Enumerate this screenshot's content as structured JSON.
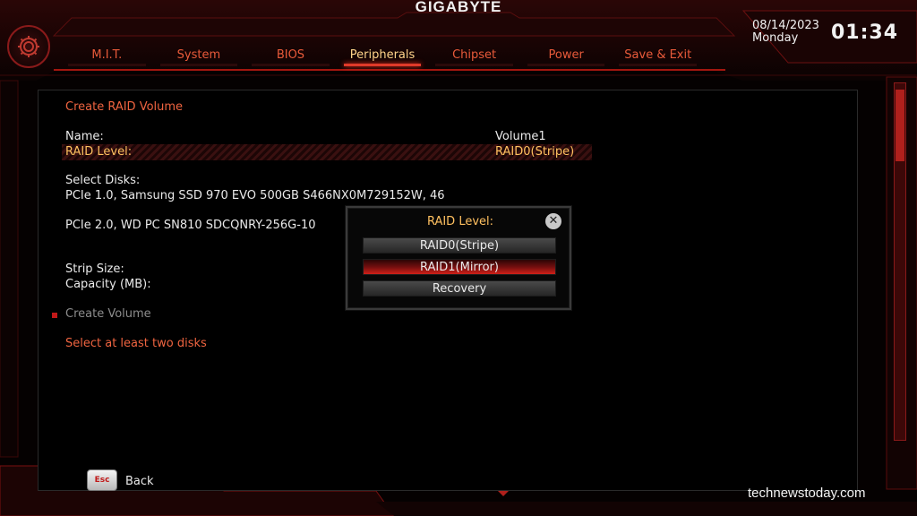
{
  "brand": "GIGABYTE",
  "header": {
    "date": "08/14/2023",
    "day": "Monday",
    "time": "01:34"
  },
  "tabs": [
    {
      "label": "M.I.T.",
      "active": false
    },
    {
      "label": "System",
      "active": false
    },
    {
      "label": "BIOS",
      "active": false
    },
    {
      "label": "Peripherals",
      "active": true
    },
    {
      "label": "Chipset",
      "active": false
    },
    {
      "label": "Power",
      "active": false
    },
    {
      "label": "Save & Exit",
      "active": false
    }
  ],
  "main": {
    "section_title": "Create RAID Volume",
    "name_label": "Name:",
    "name_value": "Volume1",
    "raid_level_label": "RAID Level:",
    "raid_level_value": "RAID0(Stripe)",
    "select_disks_label": "Select Disks:",
    "disk1": "PCIe 1.0, Samsung SSD 970 EVO 500GB S466NX0M729152W, 46",
    "disk2": "PCIe 2.0, WD PC SN810 SDCQNRY-256G-10",
    "strip_size_label": "Strip Size:",
    "capacity_label": "Capacity (MB):",
    "create_volume": "Create Volume",
    "warning": "Select at least two disks"
  },
  "popup": {
    "title": "RAID Level:",
    "close_glyph": "✕",
    "options": [
      "RAID0(Stripe)",
      "RAID1(Mirror)",
      "Recovery"
    ],
    "selected_index": 1
  },
  "footer": {
    "esc_key": "Esc",
    "back_label": "Back"
  },
  "watermark": "technewstoday.com",
  "colors": {
    "accent_red": "#e03a2a",
    "highlight_text": "#ffc060",
    "menu_text": "#e85a3a"
  }
}
